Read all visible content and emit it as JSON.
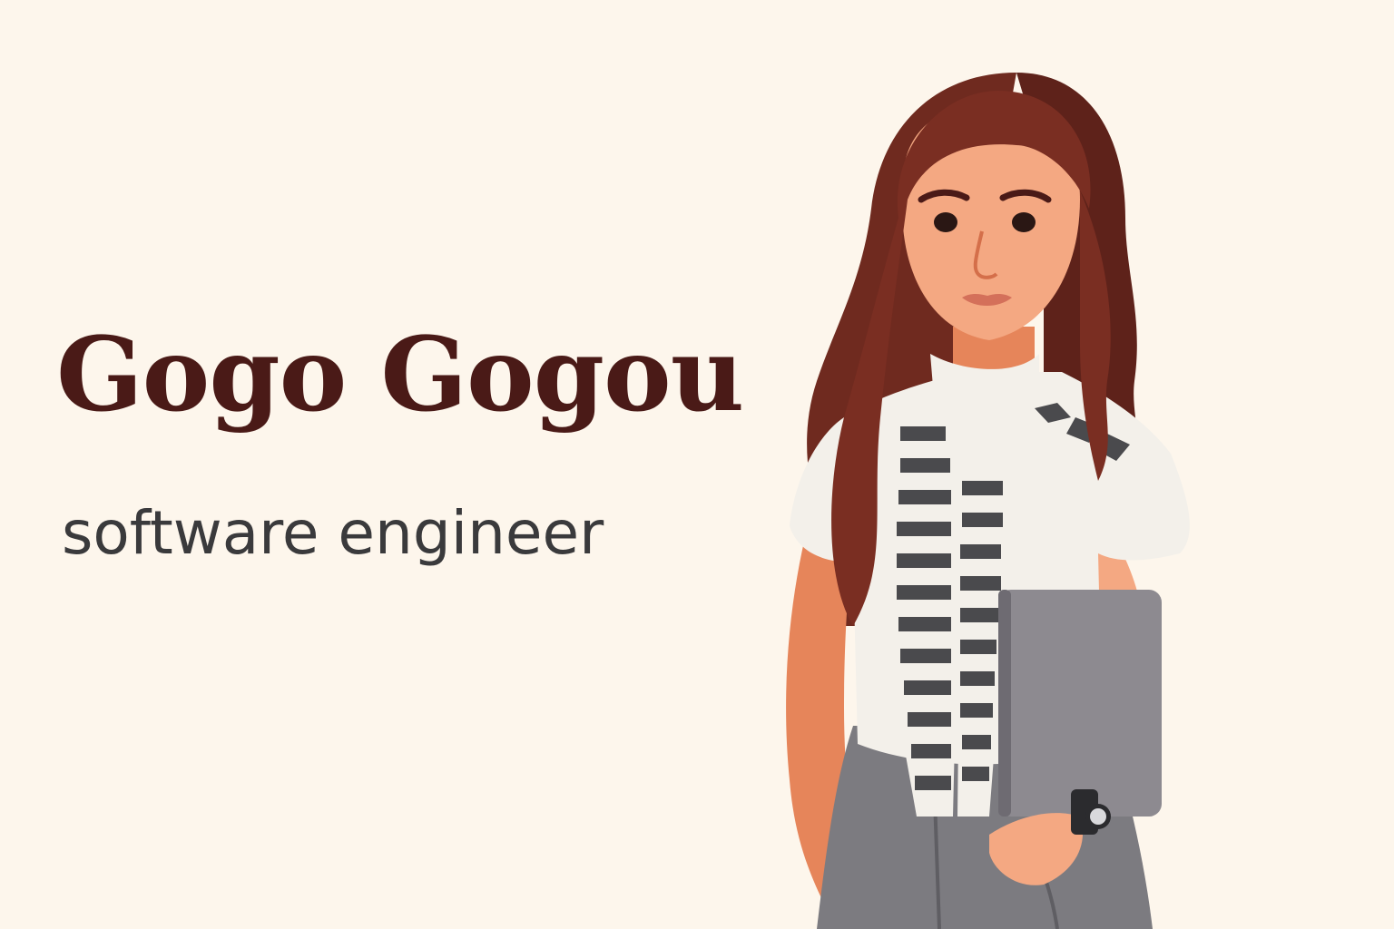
{
  "profile": {
    "name": "Gogo Gogou",
    "role": "software engineer"
  },
  "illustration": {
    "subject": "woman-with-laptop-illustration"
  },
  "colors": {
    "background": "#fdf6ec",
    "name_text": "#4a1a17",
    "role_text": "#3a3a3c",
    "hair": "#6f2a1f",
    "skin": "#f4a882",
    "shirt": "#f3f0ea",
    "scarf_stripe": "#4a4a4d",
    "pants": "#7c7b80",
    "laptop": "#8d8a90"
  }
}
